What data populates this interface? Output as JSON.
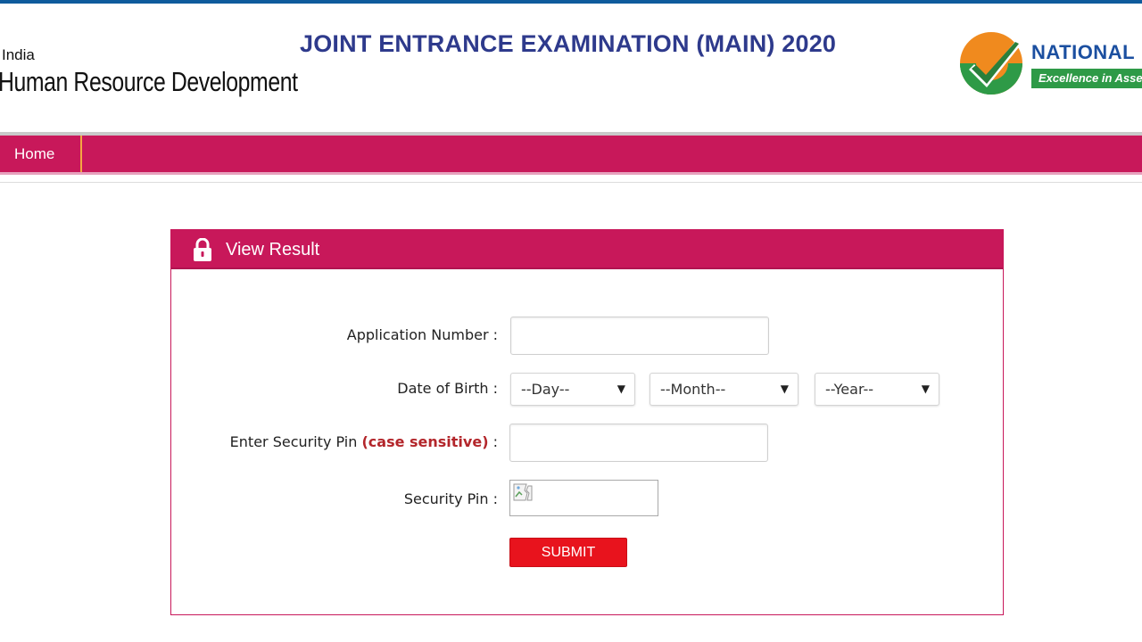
{
  "header": {
    "ministry_line1": "India",
    "ministry_line2": "Human Resource Development",
    "exam_title": "JOINT ENTRANCE EXAMINATION (MAIN) 2020",
    "agency_name": "NATIONAL",
    "agency_tagline": "Excellence in Assessment",
    "logo_icon": "nta-check-logo-icon"
  },
  "nav": {
    "items": [
      {
        "label": "Home"
      }
    ]
  },
  "form": {
    "title": "View Result",
    "title_icon": "lock-icon",
    "application_number": {
      "label": "Application Number :",
      "value": ""
    },
    "date_of_birth": {
      "label": "Date of Birth :",
      "day": "--Day--",
      "month": "--Month--",
      "year": "--Year--"
    },
    "security_pin_input": {
      "label_prefix": "Enter Security Pin ",
      "label_emphasis": "(case sensitive)",
      "label_suffix": " :",
      "value": ""
    },
    "security_pin_image": {
      "label": "Security Pin :",
      "icon": "broken-image-icon"
    },
    "submit_label": "SUBMIT"
  },
  "colors": {
    "brand": "#c8185a",
    "title_blue": "#2e3a8c",
    "submit_red": "#e8131d",
    "top_stripe": "#0f5b9c",
    "nav_divider": "#f4a742"
  }
}
